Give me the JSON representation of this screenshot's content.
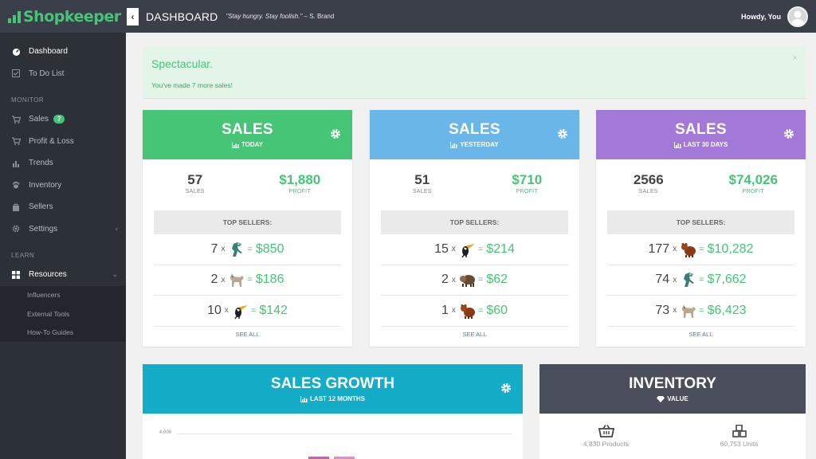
{
  "app": {
    "logo_text": "Shopkeeper",
    "brand_color": "#46c576"
  },
  "header": {
    "title": "DASHBOARD",
    "quote": "\"Stay hungry. Stay foolish.\"",
    "quote_author": " – S. Brand",
    "greeting": "Howdy, You"
  },
  "sidebar": {
    "dashboard": "Dashboard",
    "todo": "To Do List",
    "monitor_section": "MONITOR",
    "sales": "Sales",
    "sales_badge": "7",
    "profit_loss": "Profit & Loss",
    "trends": "Trends",
    "inventory": "Inventory",
    "sellers": "Sellers",
    "settings": "Settings",
    "learn_section": "LEARN",
    "resources": "Resources",
    "influencers": "Influencers",
    "external_tools": "External Tools",
    "howto": "How-To Guides"
  },
  "alert": {
    "title": "Spectacular.",
    "text": "You've made 7 more sales!",
    "close": "×"
  },
  "cards": [
    {
      "title": "SALES",
      "subtitle": "TODAY",
      "color": "#46c576",
      "sales": "57",
      "sales_label": "SALES",
      "profit": "$1,880",
      "profit_label": "PROFIT",
      "top_label": "TOP SELLERS:",
      "sellers": [
        {
          "qty": "7",
          "x": "x",
          "pet": "raptor-icon",
          "eq": "=",
          "amount": "$850"
        },
        {
          "qty": "2",
          "x": "x",
          "pet": "dog-icon",
          "eq": "=",
          "amount": "$186"
        },
        {
          "qty": "10",
          "x": "x",
          "pet": "toucan-icon",
          "eq": "=",
          "amount": "$142"
        }
      ],
      "see_all": "SEE ALL"
    },
    {
      "title": "SALES",
      "subtitle": "YESTERDAY",
      "color": "#6bb6e8",
      "sales": "51",
      "sales_label": "SALES",
      "profit": "$710",
      "profit_label": "PROFIT",
      "top_label": "TOP SELLERS:",
      "sellers": [
        {
          "qty": "15",
          "x": "x",
          "pet": "toucan-icon",
          "eq": "=",
          "amount": "$214"
        },
        {
          "qty": "2",
          "x": "x",
          "pet": "bison-icon",
          "eq": "=",
          "amount": "$62"
        },
        {
          "qty": "1",
          "x": "x",
          "pet": "bear-icon",
          "eq": "=",
          "amount": "$60"
        }
      ],
      "see_all": "SEE ALL"
    },
    {
      "title": "SALES",
      "subtitle": "LAST 30 DAYS",
      "color": "#a279d6",
      "sales": "2566",
      "sales_label": "SALES",
      "profit": "$74,026",
      "profit_label": "PROFIT",
      "top_label": "TOP SELLERS:",
      "sellers": [
        {
          "qty": "177",
          "x": "x",
          "pet": "bear-icon",
          "eq": "=",
          "amount": "$10,282"
        },
        {
          "qty": "74",
          "x": "x",
          "pet": "raptor-icon",
          "eq": "=",
          "amount": "$7,662"
        },
        {
          "qty": "73",
          "x": "x",
          "pet": "dog-icon",
          "eq": "=",
          "amount": "$6,423"
        }
      ],
      "see_all": "SEE ALL"
    }
  ],
  "growth": {
    "title": "SALES GROWTH",
    "subtitle": "LAST 12 MONTHS",
    "axis_tick": "4,000",
    "color": "#14acc7"
  },
  "inventory": {
    "title": "INVENTORY",
    "subtitle": "VALUE",
    "products": "4,830 Products",
    "units": "60,753 Units",
    "color": "#4a4e5c"
  }
}
